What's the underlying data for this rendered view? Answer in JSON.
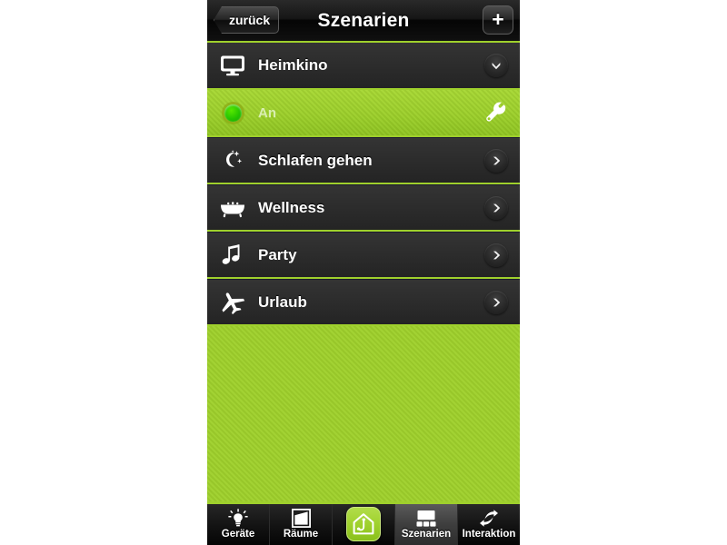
{
  "app": {
    "screen_name": "Szenarien",
    "accent_green": "#9fd02c",
    "row_dark": "#2c2c2c"
  },
  "header": {
    "title": "Szenarien",
    "back_label": "zurück",
    "add_label": "+",
    "back_icon": "chevron-left-icon",
    "add_icon": "plus-icon"
  },
  "scenes": [
    {
      "label": "Heimkino",
      "icon": "television-icon",
      "action_icon": "chevron-down-icon",
      "expanded": true,
      "state": {
        "label": "An",
        "indicator": "status-on-dot",
        "action_icon": "wrench-icon"
      }
    },
    {
      "label": "Schlafen gehen",
      "icon": "moon-stars-icon",
      "action_icon": "chevron-right-icon",
      "expanded": false
    },
    {
      "label": "Wellness",
      "icon": "bathtub-icon",
      "action_icon": "chevron-right-icon",
      "expanded": false
    },
    {
      "label": "Party",
      "icon": "music-note-icon",
      "action_icon": "chevron-right-icon",
      "expanded": false
    },
    {
      "label": "Urlaub",
      "icon": "airplane-icon",
      "action_icon": "chevron-right-icon",
      "expanded": false
    }
  ],
  "tabbar": {
    "items": [
      {
        "label": "Geräte",
        "icon": "lightbulb-icon",
        "active": false
      },
      {
        "label": "Räume",
        "icon": "room-corner-icon",
        "active": false
      },
      {
        "label": "",
        "icon": "home-plug-icon",
        "active": false,
        "is_home": true
      },
      {
        "label": "Szenarien",
        "icon": "scenes-grid-icon",
        "active": true
      },
      {
        "label": "Interaktion",
        "icon": "exchange-arrows-icon",
        "active": false
      }
    ]
  }
}
